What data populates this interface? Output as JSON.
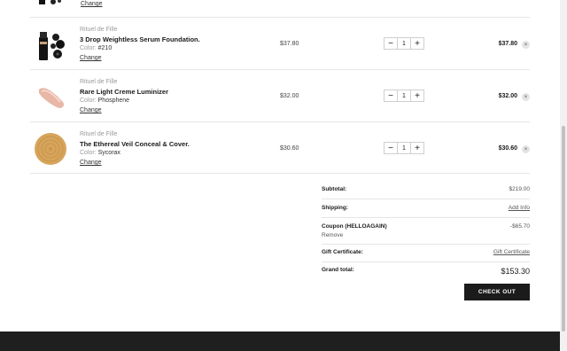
{
  "previous_item": {
    "change_label": "Change"
  },
  "items": [
    {
      "brand": "Rituel de Fille",
      "name": "3 Drop Weightless Serum Foundation.",
      "variant_label": "Color:",
      "variant_value": "#210",
      "change_label": "Change",
      "price": "$37.80",
      "quantity": "1",
      "minus": "−",
      "plus": "+",
      "total": "$37.80",
      "remove": "×",
      "thumb_icon": "foundation-bottle-icon"
    },
    {
      "brand": "Rituel de Fille",
      "name": "Rare Light Creme Luminizer",
      "variant_label": "Color:",
      "variant_value": "Phosphene",
      "change_label": "Change",
      "price": "$32.00",
      "quantity": "1",
      "minus": "−",
      "plus": "+",
      "total": "$32.00",
      "remove": "×",
      "thumb_icon": "luminizer-swatch-icon"
    },
    {
      "brand": "Rituel de Fille",
      "name": "The Ethereal Veil Conceal & Cover.",
      "variant_label": "Color:",
      "variant_value": "Sycorax",
      "change_label": "Change",
      "price": "$30.60",
      "quantity": "1",
      "minus": "−",
      "plus": "+",
      "total": "$30.60",
      "remove": "×",
      "thumb_icon": "concealer-texture-icon"
    }
  ],
  "summary": {
    "subtotal_label": "Subtotal:",
    "subtotal_value": "$219.00",
    "shipping_label": "Shipping:",
    "shipping_value": "Add Info",
    "coupon_label": "Coupon (HELLOAGAIN)",
    "coupon_value": "-$65.70",
    "coupon_remove": "Remove",
    "gift_label": "Gift Certificate:",
    "gift_value": "Gift Certificate",
    "grand_label": "Grand total:",
    "grand_value": "$153.30",
    "checkout_label": "CHECK OUT"
  },
  "colors": {
    "button_bg": "#1b1b1b",
    "footer_bg": "#1f1f1f",
    "muted_text": "#9a9a9a"
  }
}
